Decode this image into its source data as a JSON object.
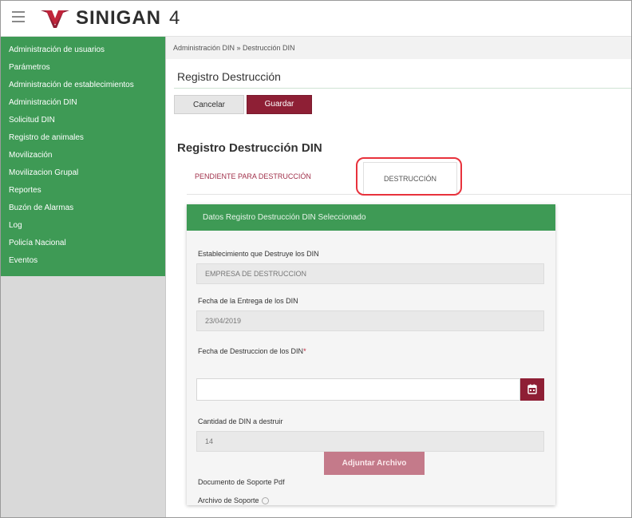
{
  "header": {
    "brand": "SINIGAN",
    "version": "4"
  },
  "sidebar": {
    "items": [
      {
        "label": "Administración de usuarios"
      },
      {
        "label": "Parámetros"
      },
      {
        "label": "Administración de establecimientos"
      },
      {
        "label": "Administración DIN"
      },
      {
        "label": "Solicitud DIN"
      },
      {
        "label": "Registro de animales"
      },
      {
        "label": "Movilización"
      },
      {
        "label": "Movilizacion Grupal"
      },
      {
        "label": "Reportes"
      },
      {
        "label": "Buzón de Alarmas"
      },
      {
        "label": "Log"
      },
      {
        "label": "Policía Nacional"
      },
      {
        "label": "Eventos"
      }
    ]
  },
  "breadcrumb": {
    "text": "Administración DIN » Destrucción DIN"
  },
  "page": {
    "title": "Registro Destrucción"
  },
  "toolbar": {
    "cancel_label": "Cancelar",
    "save_label": "Guardar"
  },
  "section": {
    "title": "Registro Destrucción DIN"
  },
  "tabs": {
    "pending": "PENDIENTE PARA DESTRUCCIÓN",
    "active": "DESTRUCCIÓN"
  },
  "card": {
    "header": "Datos Registro Destrucción DIN Seleccionado",
    "establishment_label": "Establecimiento que Destruye los DIN",
    "establishment_value": "EMPRESA DE DESTRUCCION",
    "delivery_date_label": "Fecha de la Entrega de los DIN",
    "delivery_date_value": "23/04/2019",
    "destruction_date_label": "Fecha de Destruccion de los DIN",
    "required_mark": "*",
    "destruction_date_value": "",
    "quantity_label": "Cantidad de DIN a destruir",
    "quantity_value": "14",
    "support_doc_label": "Documento de Soporte Pdf",
    "attach_button": "Adjuntar Archivo",
    "support_file_label": "Archivo de Soporte"
  },
  "colors": {
    "green": "#3e9a55",
    "maroon": "#8e1f35",
    "highlight": "#e8323c"
  },
  "icons": {
    "menu": "hamburger-icon",
    "calendar": "calendar-icon",
    "logo": "cow-logo-icon",
    "help": "help-icon"
  }
}
